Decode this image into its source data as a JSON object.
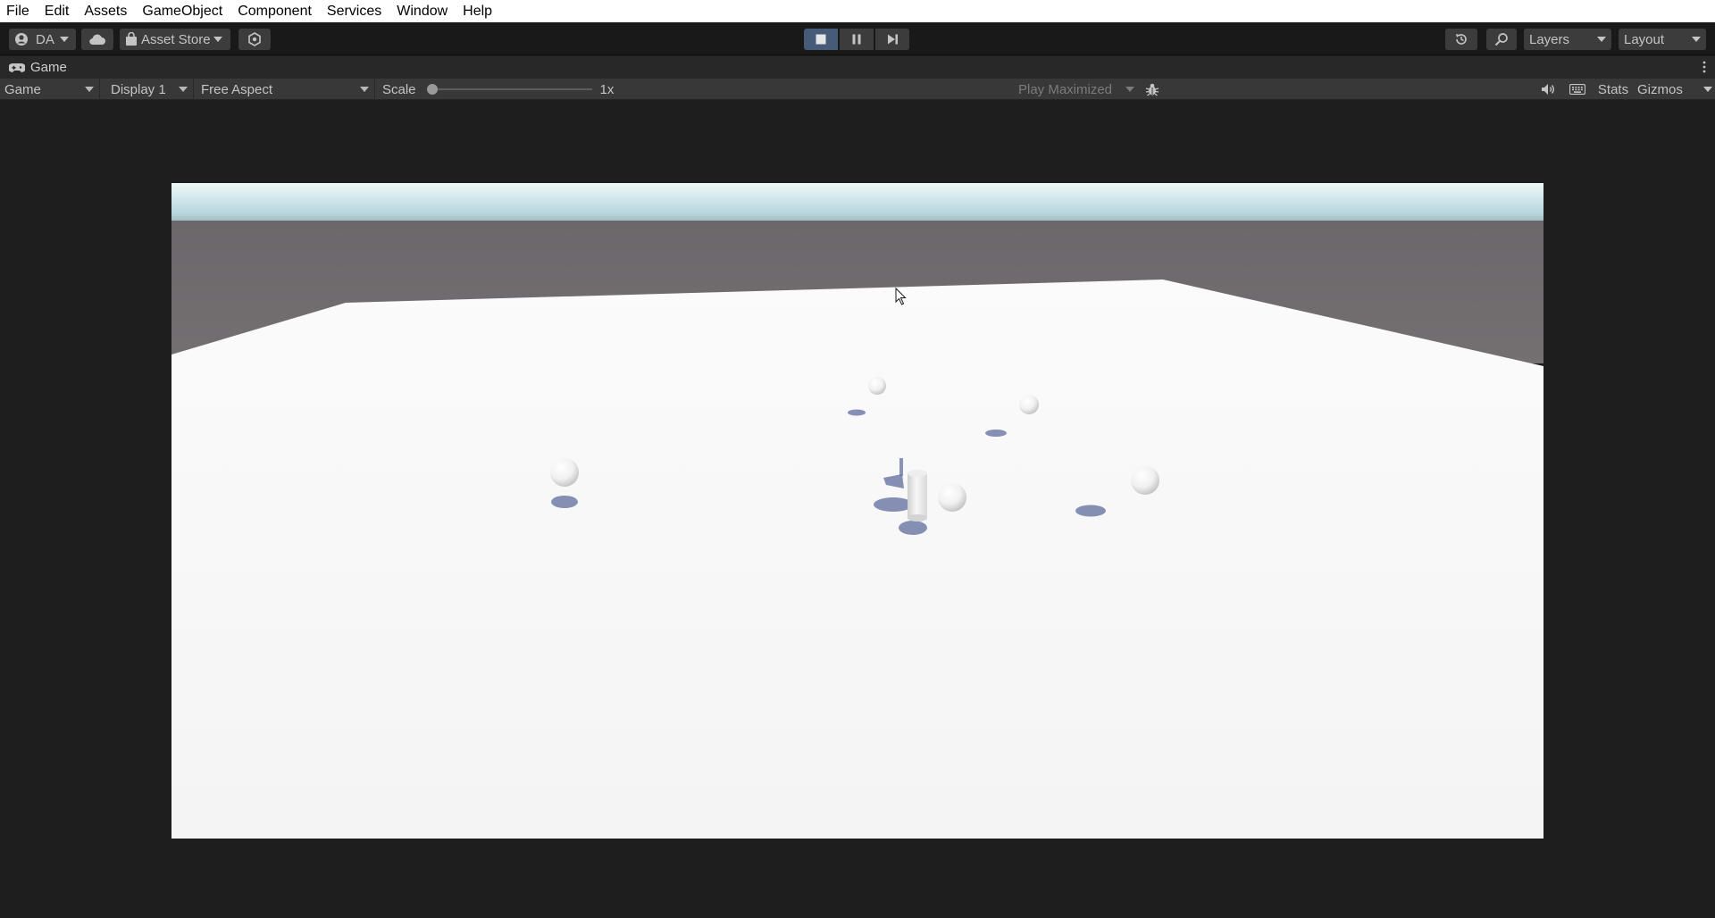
{
  "menu": [
    "File",
    "Edit",
    "Assets",
    "GameObject",
    "Component",
    "Services",
    "Window",
    "Help"
  ],
  "toolbar": {
    "account_label": "DA",
    "asset_store_label": "Asset Store",
    "layers_label": "Layers",
    "layout_label": "Layout"
  },
  "tab": {
    "title": "Game"
  },
  "gameview": {
    "mode": "Game",
    "display": "Display 1",
    "aspect": "Free Aspect",
    "scale_label": "Scale",
    "scale_value": "1x",
    "scale_fraction": 0.0,
    "play_mode": "Play Maximized",
    "stats_label": "Stats",
    "gizmos_label": "Gizmos"
  },
  "colors": {
    "sky_top": "#eaf7f9",
    "sky_horizon": "#aecfd6",
    "wall": "#6e6a6d",
    "floor": "#f6f6f6",
    "shadow": "#5b6a9a",
    "play_active": "#465b78"
  }
}
